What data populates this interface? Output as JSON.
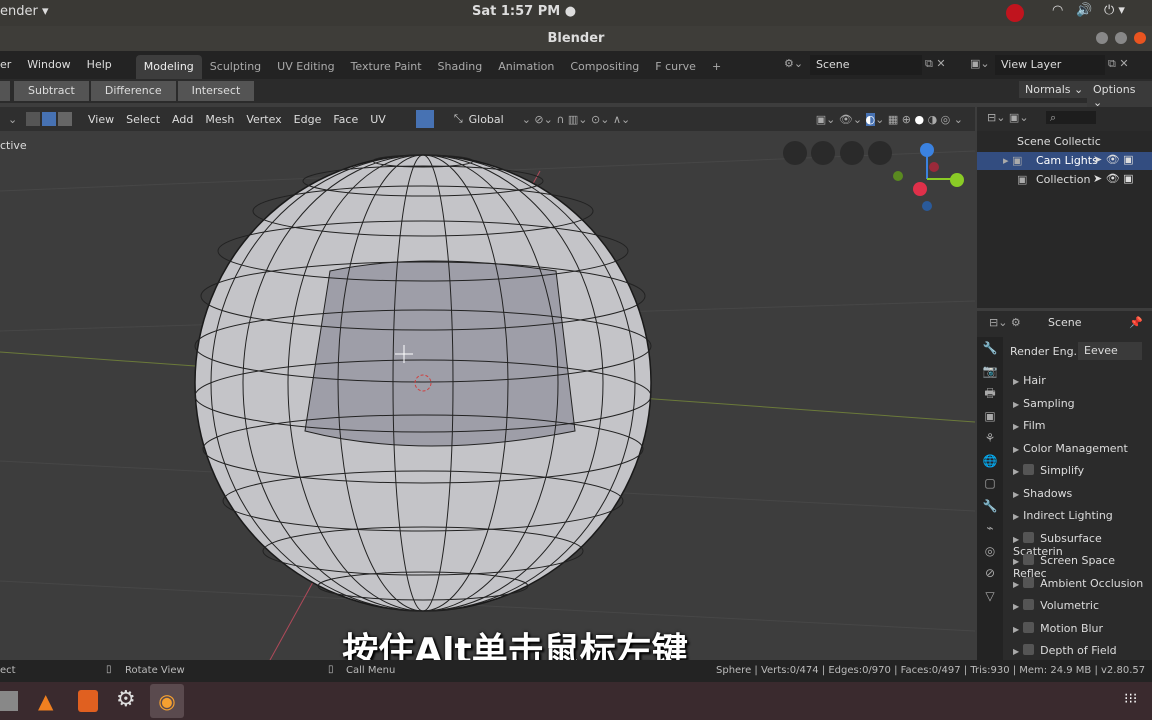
{
  "topbar": {
    "app_menu": "ender ▾",
    "clock": "Sat  1:57 PM ●"
  },
  "window": {
    "title": "Blender"
  },
  "menu": {
    "items": [
      "er",
      "Window",
      "Help"
    ],
    "tabs": [
      "Modeling",
      "Sculpting",
      "UV Editing",
      "Texture Paint",
      "Shading",
      "Animation",
      "Compositing",
      "F curve",
      "+"
    ],
    "scene": "Scene",
    "view_layer": "View Layer"
  },
  "toolheader": {
    "buttons": [
      "Subtract",
      "Difference",
      "Intersect"
    ],
    "normals": "Normals ⌄",
    "options": "Options ⌄"
  },
  "viewport_header": {
    "menus": [
      "View",
      "Select",
      "Add",
      "Mesh",
      "Vertex",
      "Edge",
      "Face",
      "UV"
    ],
    "orientation": "Global"
  },
  "viewport": {
    "label": "ctive"
  },
  "outliner": {
    "items": [
      "Scene Collectic",
      "Cam Lights",
      "Collection"
    ]
  },
  "properties": {
    "title": "Scene",
    "render_engine_label": "Render Eng..",
    "render_engine": "Eevee",
    "panels": [
      {
        "label": "Hair",
        "check": false
      },
      {
        "label": "Sampling",
        "check": false
      },
      {
        "label": "Film",
        "check": false
      },
      {
        "label": "Color Management",
        "check": false
      },
      {
        "label": "Simplify",
        "check": true
      },
      {
        "label": "Shadows",
        "check": false
      },
      {
        "label": "Indirect Lighting",
        "check": false
      },
      {
        "label": "Subsurface Scatterin",
        "check": true
      },
      {
        "label": "Screen Space Reflec",
        "check": true
      },
      {
        "label": "Ambient Occlusion",
        "check": true
      },
      {
        "label": "Volumetric",
        "check": true
      },
      {
        "label": "Motion Blur",
        "check": true
      },
      {
        "label": "Depth of Field",
        "check": true
      }
    ]
  },
  "statusbar": {
    "left": "ect",
    "rotate": "Rotate View",
    "call": "Call Menu",
    "stats": "Sphere | Verts:0/474 | Edges:0/970 | Faces:0/497 | Tris:930 | Mem: 24.9 MB | v2.80.57"
  },
  "subtitle": "按住Alt单击鼠标左键"
}
